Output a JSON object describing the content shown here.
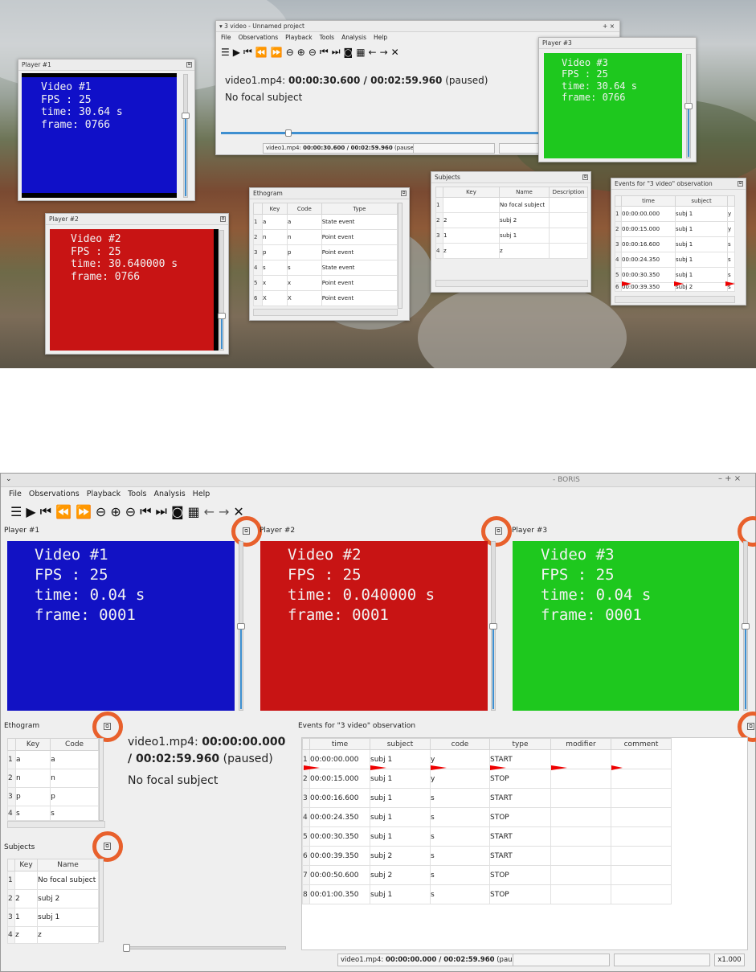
{
  "top": {
    "main_window": {
      "title": "3 video - Unnamed project",
      "menu": [
        "File",
        "Observations",
        "Playback",
        "Tools",
        "Analysis",
        "Help"
      ],
      "media_file": "video1.mp4:",
      "media_time": "00:00:30.600 / 00:02:59.960",
      "media_state": "(paused)",
      "focal": "No focal subject",
      "status_file": "video1.mp4:",
      "status_time": "00:00:30.600 / 00:02:59.960",
      "status_state": "(paused)"
    },
    "player1": {
      "title": "Player #1",
      "line1": "Video #1",
      "line2": "FPS : 25",
      "line3": "time: 30.64 s",
      "line4": "frame: 0766",
      "bg": "#1010c8"
    },
    "player2": {
      "title": "Player #2",
      "line1": "Video #2",
      "line2": "FPS : 25",
      "line3": "time: 30.640000 s",
      "line4": "frame: 0766",
      "bg": "#c81414"
    },
    "player3": {
      "title": "Player #3",
      "line1": "Video #3",
      "line2": "FPS : 25",
      "line3": "time: 30.64 s",
      "line4": "frame: 0766",
      "bg": "#1ec81e"
    },
    "ethogram": {
      "title": "Ethogram",
      "headers": [
        "Key",
        "Code",
        "Type"
      ],
      "rows": [
        {
          "n": "1",
          "key": "a",
          "code": "a",
          "type": "State event"
        },
        {
          "n": "2",
          "key": "n",
          "code": "n",
          "type": "Point event"
        },
        {
          "n": "3",
          "key": "p",
          "code": "p",
          "type": "Point event"
        },
        {
          "n": "4",
          "key": "s",
          "code": "s",
          "type": "State event"
        },
        {
          "n": "5",
          "key": "x",
          "code": "x",
          "type": "Point event"
        },
        {
          "n": "6",
          "key": "X",
          "code": "X",
          "type": "Point event"
        }
      ]
    },
    "subjects": {
      "title": "Subjects",
      "headers": [
        "Key",
        "Name",
        "Description"
      ],
      "rows": [
        {
          "n": "1",
          "key": "",
          "name": "No focal subject"
        },
        {
          "n": "2",
          "key": "2",
          "name": "subj 2"
        },
        {
          "n": "3",
          "key": "1",
          "name": "subj 1"
        },
        {
          "n": "4",
          "key": "z",
          "name": "z"
        }
      ]
    },
    "events": {
      "title": "Events for \"3 video\" observation",
      "headers": [
        "time",
        "subject"
      ],
      "rows": [
        {
          "n": "1",
          "time": "00:00:00.000",
          "subject": "subj 1",
          "code": "y"
        },
        {
          "n": "2",
          "time": "00:00:15.000",
          "subject": "subj 1",
          "code": "y"
        },
        {
          "n": "3",
          "time": "00:00:16.600",
          "subject": "subj 1",
          "code": "s"
        },
        {
          "n": "4",
          "time": "00:00:24.350",
          "subject": "subj 1",
          "code": "s"
        },
        {
          "n": "5",
          "time": "00:00:30.350",
          "subject": "subj 1",
          "code": "s"
        },
        {
          "n": "6",
          "time": "00:00:39.350",
          "subject": "subj 2",
          "code": "s"
        }
      ]
    }
  },
  "bottom": {
    "window_title": "- BORIS",
    "menu": [
      "File",
      "Observations",
      "Playback",
      "Tools",
      "Analysis",
      "Help"
    ],
    "player1": {
      "title": "Player #1",
      "line1": "Video #1",
      "line2": "FPS : 25",
      "line3": "time: 0.04 s",
      "line4": "frame: 0001",
      "bg": "#1212c4"
    },
    "player2": {
      "title": "Player #2",
      "line1": "Video #2",
      "line2": "FPS : 25",
      "line3": "time: 0.040000 s",
      "line4": "frame: 0001",
      "bg": "#c81414"
    },
    "player3": {
      "title": "Player #3",
      "line1": "Video #3",
      "line2": "FPS : 25",
      "line3": "time: 0.04 s",
      "line4": "frame: 0001",
      "bg": "#1ec81e"
    },
    "ethogram": {
      "title": "Ethogram",
      "headers": [
        "Key",
        "Code"
      ],
      "rows": [
        {
          "n": "1",
          "key": "a",
          "code": "a"
        },
        {
          "n": "2",
          "key": "n",
          "code": "n"
        },
        {
          "n": "3",
          "key": "p",
          "code": "p"
        },
        {
          "n": "4",
          "key": "s",
          "code": "s"
        }
      ]
    },
    "subjects": {
      "title": "Subjects",
      "headers": [
        "Key",
        "Name"
      ],
      "rows": [
        {
          "n": "1",
          "key": "",
          "name": "No focal subject"
        },
        {
          "n": "2",
          "key": "2",
          "name": "subj 2"
        },
        {
          "n": "3",
          "key": "1",
          "name": "subj 1"
        },
        {
          "n": "4",
          "key": "z",
          "name": "z"
        }
      ]
    },
    "media": {
      "file": "video1.mp4:",
      "time": "00:00:00.000",
      "duration": "/ 00:02:59.960",
      "state": "(paused)",
      "focal": "No focal subject"
    },
    "events": {
      "title": "Events for \"3 video\" observation",
      "headers": [
        "time",
        "subject",
        "code",
        "type",
        "modifier",
        "comment"
      ],
      "rows": [
        {
          "n": "1",
          "time": "00:00:00.000",
          "subject": "subj 1",
          "code": "y",
          "type": "START"
        },
        {
          "n": "2",
          "time": "00:00:15.000",
          "subject": "subj 1",
          "code": "y",
          "type": "STOP"
        },
        {
          "n": "3",
          "time": "00:00:16.600",
          "subject": "subj 1",
          "code": "s",
          "type": "START"
        },
        {
          "n": "4",
          "time": "00:00:24.350",
          "subject": "subj 1",
          "code": "s",
          "type": "STOP"
        },
        {
          "n": "5",
          "time": "00:00:30.350",
          "subject": "subj 1",
          "code": "s",
          "type": "START"
        },
        {
          "n": "6",
          "time": "00:00:39.350",
          "subject": "subj 2",
          "code": "s",
          "type": "START"
        },
        {
          "n": "7",
          "time": "00:00:50.600",
          "subject": "subj 2",
          "code": "s",
          "type": "STOP"
        },
        {
          "n": "8",
          "time": "00:01:00.350",
          "subject": "subj 1",
          "code": "s",
          "type": "STOP"
        }
      ]
    },
    "status": {
      "file": "video1.mp4:",
      "time": "00:00:00.000 / 00:02:59.960",
      "state": "(paused)",
      "speed": "x1.000"
    }
  },
  "toolbar_icons": [
    "list-icon",
    "play-icon",
    "jump-start-icon",
    "rewind-icon",
    "fast-forward-icon",
    "zoom-reset-icon",
    "zoom-in-icon",
    "zoom-out-icon",
    "previous-media-icon",
    "next-media-icon",
    "snapshot-icon",
    "frame-by-frame-icon",
    "back-arrow-icon",
    "forward-arrow-icon",
    "close-observation-icon"
  ]
}
